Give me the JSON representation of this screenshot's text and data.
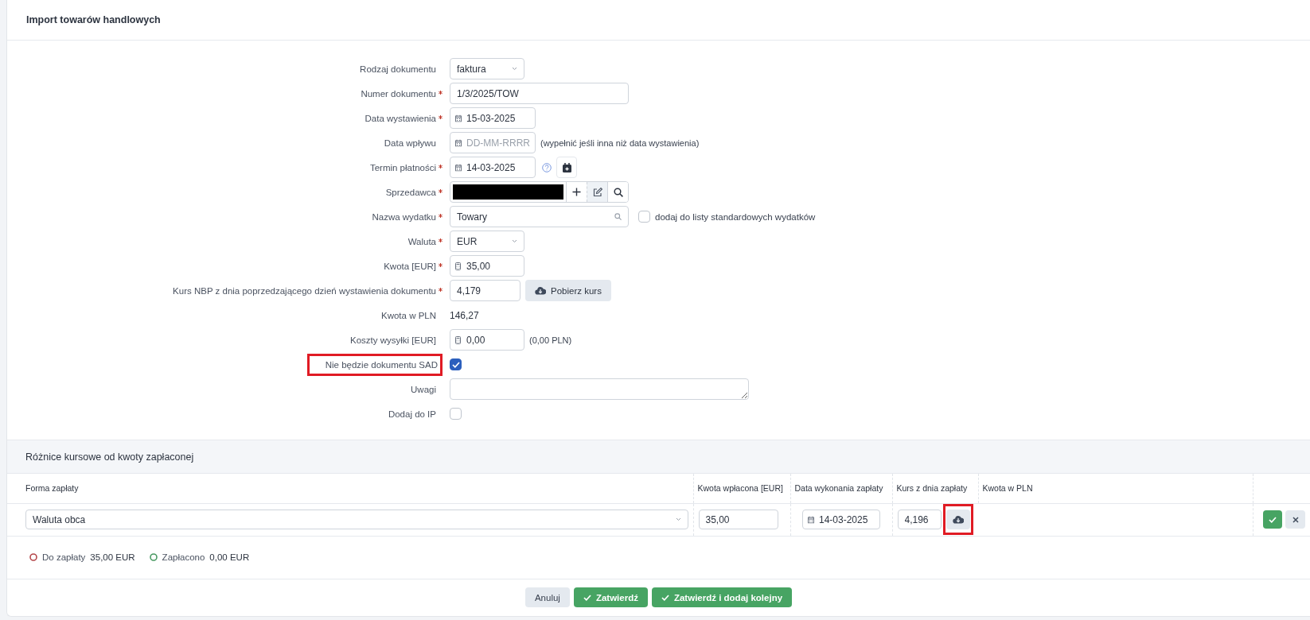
{
  "title": "Import towarów handlowych",
  "fields": [
    {
      "kind": "select",
      "label": "Rodzaj dokumentu",
      "required": false,
      "value": "faktura"
    },
    {
      "kind": "text",
      "label": "Numer dokumentu",
      "required": true,
      "value": "1/3/2025/TOW"
    },
    {
      "kind": "date",
      "label": "Data wystawienia",
      "required": true,
      "value": "15-03-2025"
    },
    {
      "kind": "date",
      "label": "Data wpływu",
      "required": false,
      "placeholder": "DD-MM-RRRR",
      "hint": "(wypełnić jeśli inna niż data wystawienia)"
    },
    {
      "kind": "due_date",
      "label": "Termin płatności",
      "required": true,
      "value": "14-03-2025"
    },
    {
      "kind": "contractor",
      "label": "Sprzedawca",
      "required": true,
      "redacted": true
    },
    {
      "kind": "search",
      "label": "Nazwa wydatku",
      "required": true,
      "value": "Towary",
      "option": {
        "label": "dodaj do listy standardowych wydatków",
        "checked": false
      }
    },
    {
      "kind": "select",
      "label": "Waluta",
      "required": true,
      "value": "EUR"
    },
    {
      "kind": "amount",
      "label": "Kwota [EUR]",
      "required": true,
      "value": "35,00"
    },
    {
      "kind": "rate",
      "label": "Kurs NBP z dnia poprzedzającego dzień wystawienia dokumentu",
      "required": true,
      "value": "4,179",
      "button": "Pobierz kurs"
    },
    {
      "kind": "display",
      "label": "Kwota w PLN",
      "required": false,
      "value": "146,27"
    },
    {
      "kind": "amount",
      "label": "Koszty wysyłki [EUR]",
      "required": false,
      "value": "0,00",
      "hint": "(0,00 PLN)"
    },
    {
      "kind": "checkbox",
      "label": "Nie będzie dokumentu SAD",
      "required": false,
      "checked": true,
      "highlighted": true
    },
    {
      "kind": "textarea",
      "label": "Uwagi",
      "required": false
    },
    {
      "kind": "checkbox",
      "label": "Dodaj do IP",
      "required": false,
      "checked": false,
      "highlighted": false
    }
  ],
  "payments": {
    "title": "Różnice kursowe od kwoty zapłaconej",
    "columns": [
      "Forma zapłaty",
      "Kwota wpłacona [EUR]",
      "Data wykonania zapłaty",
      "Kurs z dnia zapłaty",
      "Kwota w PLN"
    ],
    "rows": [
      {
        "payment_form": "Waluta obca",
        "amount": "35,00",
        "date": "14-03-2025",
        "rate": "4,196",
        "rate_button_highlighted": true
      }
    ],
    "summary": [
      {
        "label": "Do zapłaty",
        "value": "35,00 EUR",
        "color": "#b5474b"
      },
      {
        "label": "Zapłacono",
        "value": "0,00 EUR",
        "color": "#4a9a63"
      }
    ]
  },
  "buttons": [
    {
      "label": "Anuluj",
      "kind": "secondary"
    },
    {
      "label": "Zatwierdź",
      "kind": "primary"
    },
    {
      "label": "Zatwierdź i dodaj kolejny",
      "kind": "primary"
    }
  ]
}
